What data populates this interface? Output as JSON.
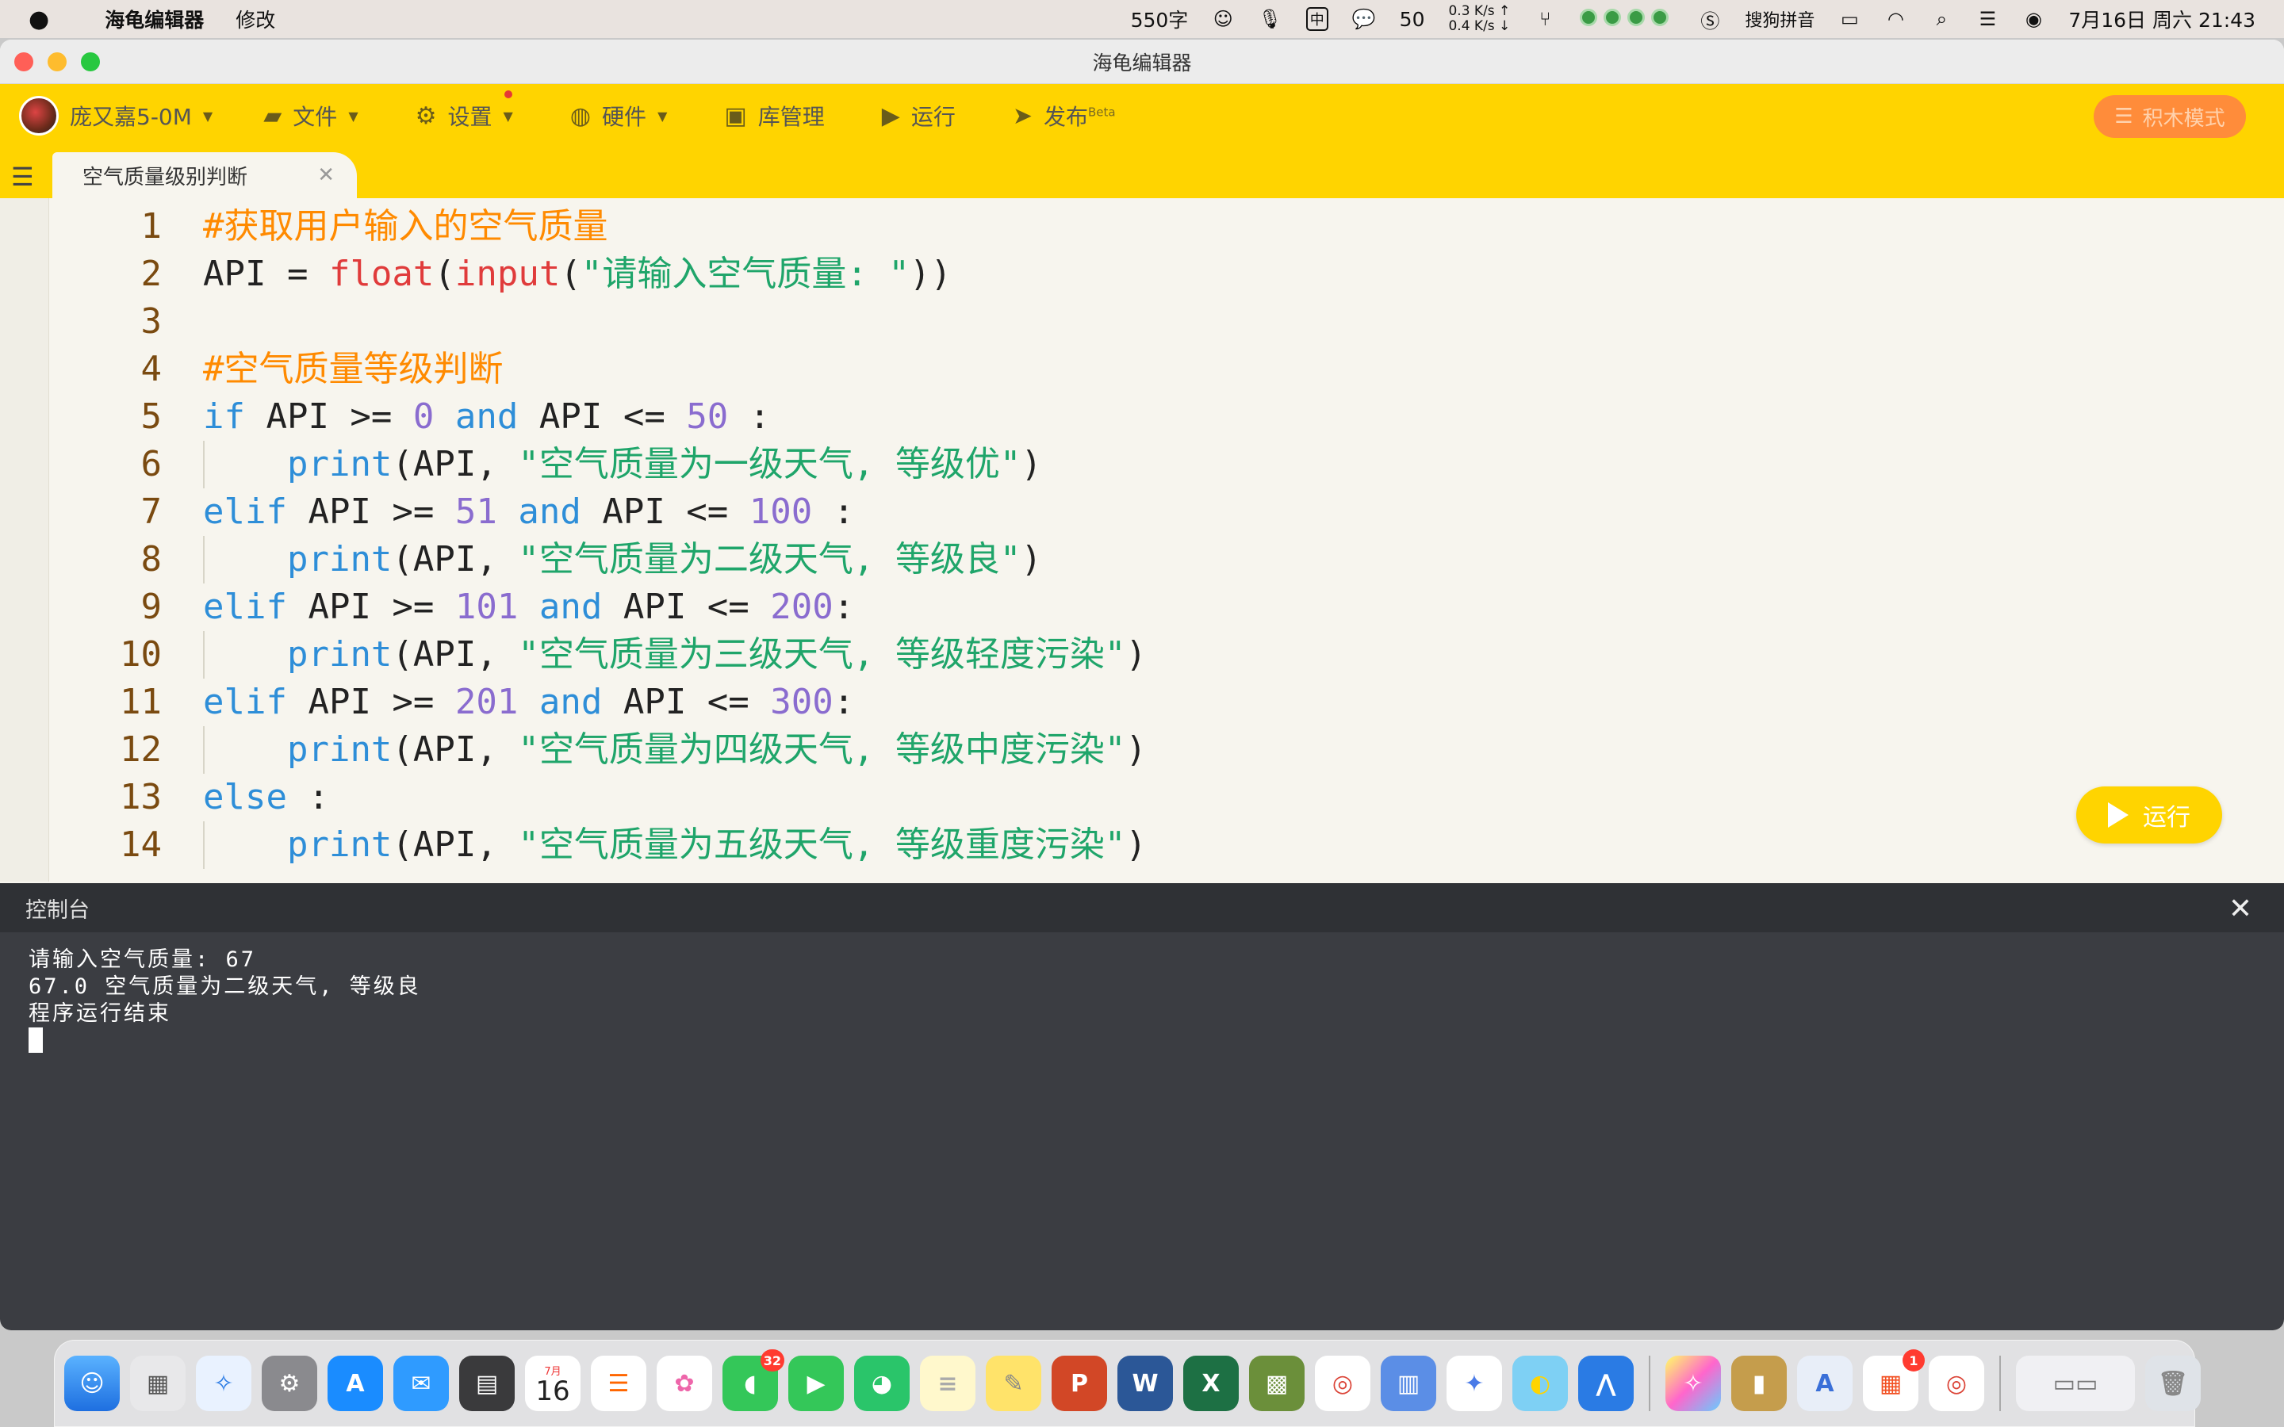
{
  "menubar": {
    "apple": "",
    "app_name": "海龟编辑器",
    "menu_edit": "修改",
    "char_count": "550字",
    "input_mode": "中",
    "wechat_count": "50",
    "net_up": "0.3 K/s ↑",
    "net_down": "0.4 K/s ↓",
    "ime_name": "搜狗拼音",
    "datetime": "7月16日 周六 21:43"
  },
  "window": {
    "title": "海龟编辑器"
  },
  "toolbar": {
    "user_name": "庞又嘉5-0M",
    "file": "文件",
    "settings": "设置",
    "hardware": "硬件",
    "library": "库管理",
    "run": "运行",
    "publish": "发布",
    "publish_tag": "Beta",
    "block_mode": "积木模式"
  },
  "tab": {
    "name": "空气质量级别判断"
  },
  "editor": {
    "line_numbers": [
      "1",
      "2",
      "3",
      "4",
      "5",
      "6",
      "7",
      "8",
      "9",
      "10",
      "11",
      "12",
      "13",
      "14"
    ],
    "run_button": "运行"
  },
  "console": {
    "title": "控制台",
    "lines": [
      "请输入空气质量: 67",
      "67.0 空气质量为二级天气, 等级良",
      "程序运行结束"
    ]
  },
  "dock": {
    "calendar_month": "7月",
    "calendar_day": "16",
    "messages_badge": "32",
    "app_badge": "1"
  }
}
